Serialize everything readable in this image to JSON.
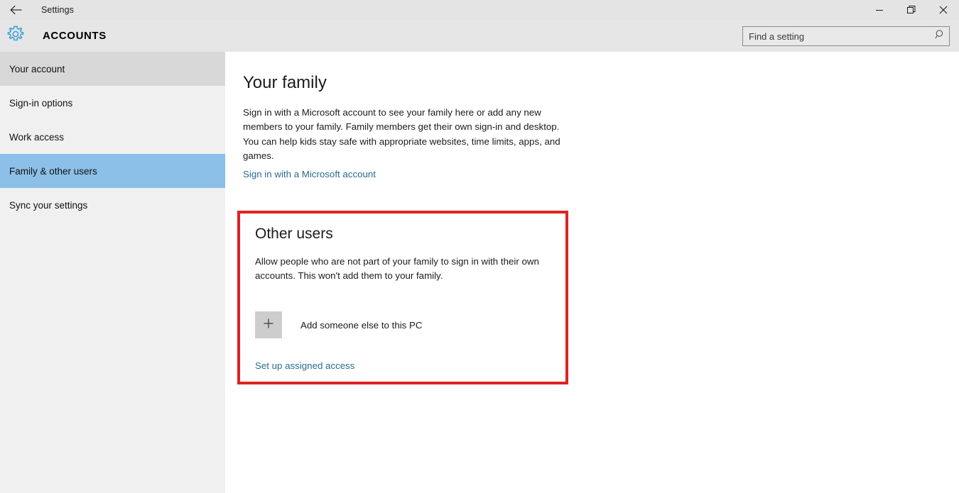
{
  "titlebar": {
    "back_icon": "back-arrow-icon",
    "app_title": "Settings",
    "minimize_icon": "minimize-icon",
    "maximize_icon": "maximize-restore-icon",
    "close_icon": "close-icon"
  },
  "header": {
    "gear_icon": "gear-icon",
    "page_title": "ACCOUNTS",
    "search": {
      "placeholder": "Find a setting",
      "value": "",
      "icon": "search-icon"
    }
  },
  "sidebar": {
    "items": [
      {
        "label": "Your account",
        "state": "hovered"
      },
      {
        "label": "Sign-in options",
        "state": "normal"
      },
      {
        "label": "Work access",
        "state": "normal"
      },
      {
        "label": "Family & other users",
        "state": "active"
      },
      {
        "label": "Sync your settings",
        "state": "normal"
      }
    ]
  },
  "main": {
    "family": {
      "heading": "Your family",
      "description": "Sign in with a Microsoft account to see your family here or add any new members to your family. Family members get their own sign-in and desktop. You can help kids stay safe with appropriate websites, time limits, apps, and games.",
      "link": "Sign in with a Microsoft account"
    },
    "other_users": {
      "heading": "Other users",
      "description": "Allow people who are not part of your family to sign in with their own accounts. This won't add them to your family.",
      "add_button_icon": "plus-icon",
      "add_button_label": "Add someone else to this PC",
      "assigned_access_link": "Set up assigned access",
      "highlight_color": "#e02222"
    }
  },
  "colors": {
    "accent_selected": "#8cc0e8",
    "link": "#2a6b8f",
    "titlebar_bg": "#e4e4e4",
    "header_bg": "#e6e6e6",
    "sidebar_bg": "#f0f0f0",
    "content_bg": "#ffffff",
    "highlight_red": "#e02222"
  }
}
